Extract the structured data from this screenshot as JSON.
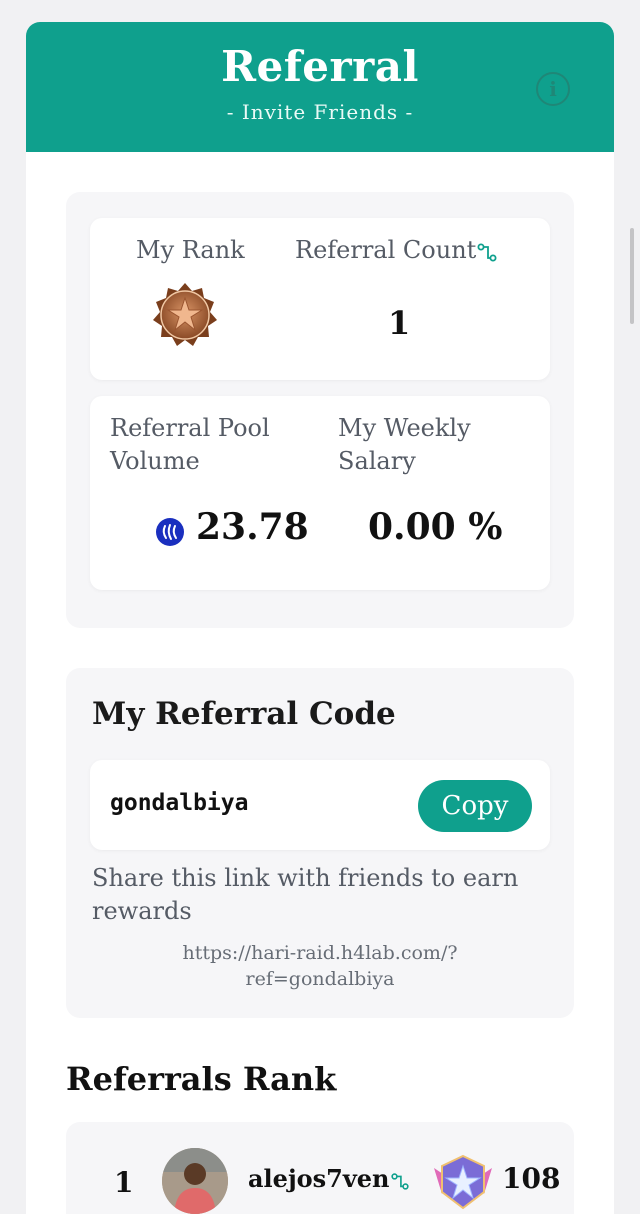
{
  "header": {
    "title": "Referral",
    "subtitle": "- Invite Friends -",
    "info_icon": "info-icon"
  },
  "stats": {
    "my_rank_label": "My Rank",
    "my_rank_icon": "bronze-star-badge-icon",
    "referral_count_label": "Referral Count",
    "referral_count_icon": "referral-link-icon",
    "referral_count_value": "1",
    "pool_volume_label": "Referral Pool Volume",
    "pool_volume_icon": "steem-icon",
    "pool_volume_value": "23.78",
    "weekly_salary_label": "My Weekly Salary",
    "weekly_salary_value": "0.00 %"
  },
  "referral_code": {
    "heading": "My Referral Code",
    "code": "gondalbiya",
    "copy_label": "Copy",
    "share_text": "Share this link with friends to earn rewards",
    "share_link_line1": "https://hari-raid.h4lab.com/?",
    "share_link_line2": "ref=gondalbiya"
  },
  "ranks": {
    "heading": "Referrals Rank",
    "rows": [
      {
        "position": "1",
        "name": "alejos7ven",
        "score": "108",
        "badge_icon": "silver-star-badge-icon"
      }
    ]
  },
  "colors": {
    "accent": "#0fa08d",
    "panel_bg": "#f6f6f8",
    "page_bg": "#f1f1f3"
  }
}
